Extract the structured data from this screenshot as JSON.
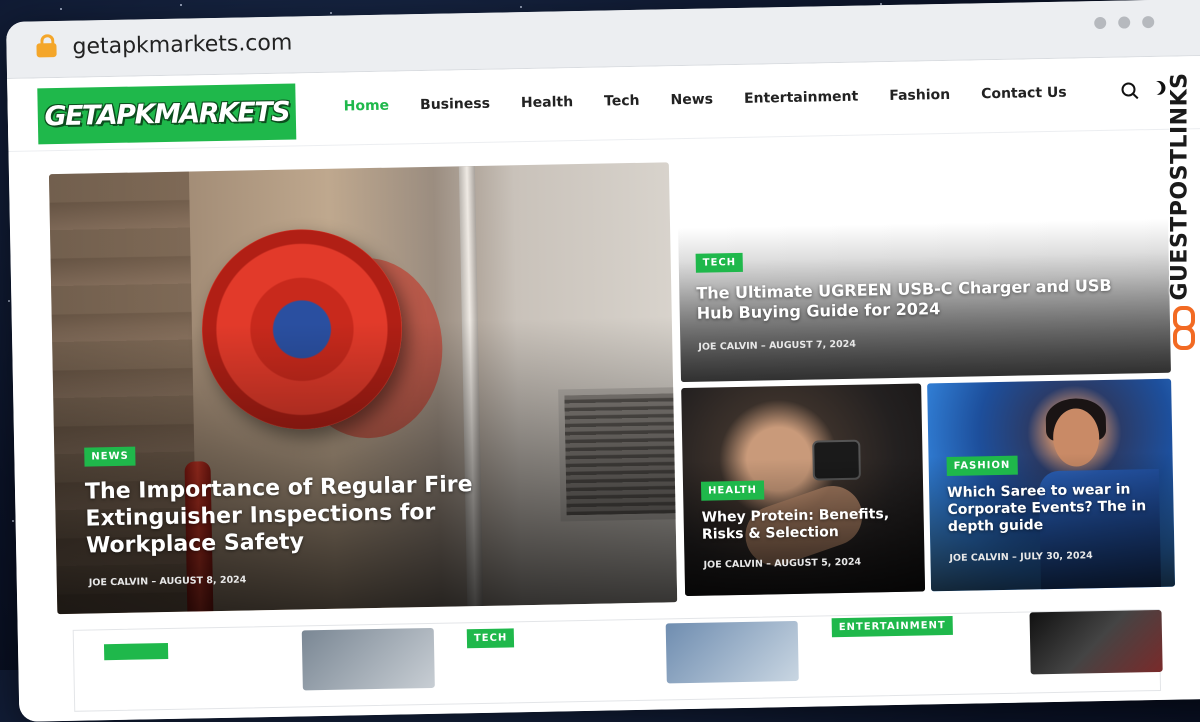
{
  "browser": {
    "url": "getapkmarkets.com"
  },
  "site": {
    "logo_text": "GETAPKMARKETS",
    "nav": [
      {
        "label": "Home",
        "active": true
      },
      {
        "label": "Business"
      },
      {
        "label": "Health"
      },
      {
        "label": "Tech"
      },
      {
        "label": "News"
      },
      {
        "label": "Entertainment"
      },
      {
        "label": "Fashion"
      },
      {
        "label": "Contact Us"
      }
    ],
    "icons": [
      "search-icon",
      "moon-icon"
    ]
  },
  "featured": [
    {
      "badge": "NEWS",
      "title": "The Importance of Regular Fire Extinguisher Inspections for Workplace Safety",
      "author": "JOE CALVIN",
      "date": "AUGUST 8, 2024"
    },
    {
      "badge": "TECH",
      "title": "The Ultimate UGREEN USB-C Charger and USB Hub Buying Guide for 2024",
      "author": "JOE CALVIN",
      "date": "AUGUST 7, 2024"
    },
    {
      "badge": "HEALTH",
      "title": "Whey Protein: Benefits, Risks & Selection",
      "author": "JOE CALVIN",
      "date": "AUGUST 5, 2024"
    },
    {
      "badge": "FASHION",
      "title": "Which Saree to wear in Corporate Events? The in depth guide",
      "author": "JOE CALVIN",
      "date": "JULY 30, 2024"
    }
  ],
  "bottom_row": {
    "badges": [
      "TECH",
      "ENTERTAINMENT"
    ]
  },
  "watermark": {
    "text": "GUESTPOSTLINKS"
  },
  "colors": {
    "accent": "#1fb84b",
    "watermark_orange": "#f26a23"
  }
}
